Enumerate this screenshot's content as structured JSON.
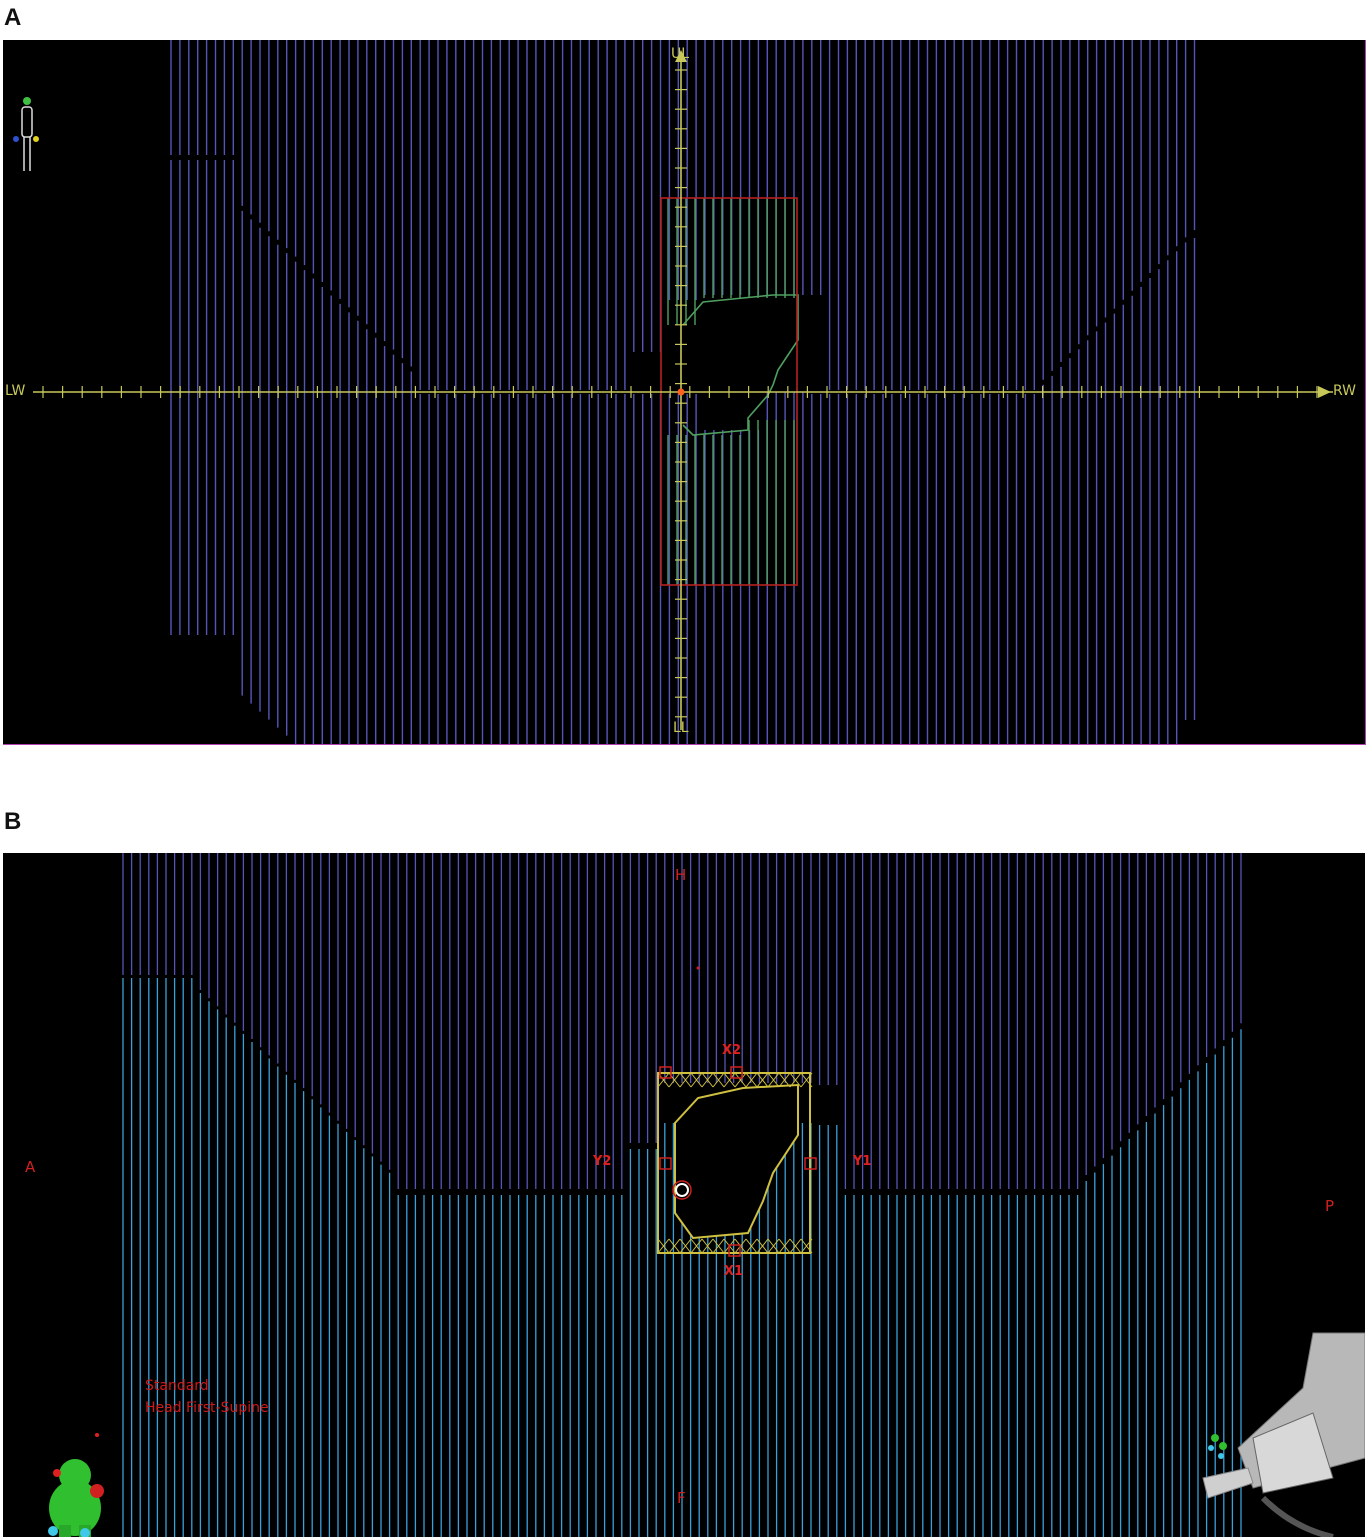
{
  "panels": [
    {
      "letter": "A",
      "labels": {
        "top": "UL",
        "bottom": "LL",
        "left": "LW",
        "right": "RW"
      }
    },
    {
      "letter": "B",
      "labels": {
        "top": "H",
        "bottom": "F",
        "left": "A",
        "right": "P",
        "jaw_x1": "X1",
        "jaw_x2": "X2",
        "jaw_y1": "Y1",
        "jaw_y2": "Y2"
      },
      "orientation": {
        "line1": "Standard",
        "line2": "Head First-Supine"
      }
    }
  ],
  "colors": {
    "leaf_upper": "#5555b8",
    "leaf_lower": "#3aa0d8",
    "axis": "#c8c85a",
    "field_outline": "#b82020",
    "aperture_green": "#4fa060",
    "aperture_yellow": "#d0c040",
    "label_red": "#d02020"
  },
  "icons": [
    "patient-figure-icon",
    "patient-3d-model-icon",
    "gantry-model-icon"
  ]
}
